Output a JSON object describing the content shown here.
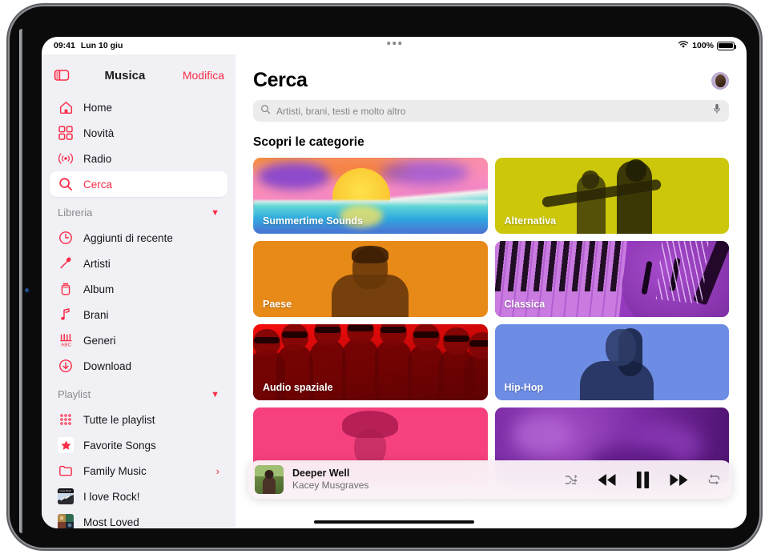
{
  "status_bar": {
    "time": "09:41",
    "date": "Lun 10 giu",
    "wifi_icon": "wifi-icon",
    "battery_percent": "100%",
    "battery_icon": "battery-full-icon",
    "multitask_handle_icon": "multitask-handle-icon"
  },
  "sidebar": {
    "toggle_icon": "sidebar-toggle-icon",
    "title": "Musica",
    "edit_label": "Modifica",
    "nav": [
      {
        "label": "Home",
        "icon": "home-icon",
        "selected": false
      },
      {
        "label": "Novità",
        "icon": "grid-squares-icon",
        "selected": false
      },
      {
        "label": "Radio",
        "icon": "radio-waves-icon",
        "selected": false
      },
      {
        "label": "Cerca",
        "icon": "search-icon",
        "selected": true
      }
    ],
    "library": {
      "header": "Libreria",
      "chevron_icon": "chevron-down-icon",
      "items": [
        {
          "label": "Aggiunti di recente",
          "icon": "clock-icon"
        },
        {
          "label": "Artisti",
          "icon": "microphone-icon"
        },
        {
          "label": "Album",
          "icon": "album-icon"
        },
        {
          "label": "Brani",
          "icon": "music-note-icon"
        },
        {
          "label": "Generi",
          "icon": "genres-icon"
        },
        {
          "label": "Download",
          "icon": "download-arrow-icon"
        }
      ]
    },
    "playlists": {
      "header": "Playlist",
      "chevron_icon": "chevron-down-icon",
      "items": [
        {
          "label": "Tutte le playlist",
          "icon": "playlist-grid-icon",
          "type": "icon"
        },
        {
          "label": "Favorite Songs",
          "icon": "star-icon",
          "type": "icon"
        },
        {
          "label": "Family Music",
          "icon": "folder-icon",
          "type": "icon",
          "disclosure_icon": "chevron-right-icon"
        },
        {
          "label": "I love Rock!",
          "icon": "playlist-artwork",
          "type": "artwork"
        },
        {
          "label": "Most Loved",
          "icon": "playlist-artwork",
          "type": "artwork"
        }
      ]
    }
  },
  "main": {
    "page_title": "Cerca",
    "avatar_icon": "account-avatar",
    "search": {
      "icon": "search-icon",
      "placeholder": "Artisti, brani, testi e molto altro",
      "mic_icon": "microphone-icon"
    },
    "categories_title": "Scopri le categorie",
    "tiles": [
      {
        "label": "Summertime Sounds",
        "art": "sunset-ocean-artwork",
        "accent": "#f9c52e"
      },
      {
        "label": "Alternativa",
        "art": "duotone-duo-photo",
        "accent": "#ccc70a"
      },
      {
        "label": "Paese",
        "art": "duotone-man-photo",
        "accent": "#e88a18"
      },
      {
        "label": "Classica",
        "art": "piano-violin-artwork",
        "accent": "#9e3fc9"
      },
      {
        "label": "Audio spaziale",
        "art": "red-crowd-artwork",
        "accent": "#f60d0d"
      },
      {
        "label": "Hip-Hop",
        "art": "duotone-woman-photo",
        "accent": "#6d8ce3"
      },
      {
        "label": "",
        "art": "pink-hat-woman-artwork",
        "accent": "#f6417e"
      },
      {
        "label": "",
        "art": "purple-smoke-artwork",
        "accent": "#7b2ba4"
      }
    ]
  },
  "mini_player": {
    "artwork_icon": "now-playing-artwork",
    "track_title": "Deeper Well",
    "artist": "Kacey Musgraves",
    "controls": [
      {
        "name": "shuffle-button",
        "icon": "shuffle-icon"
      },
      {
        "name": "rewind-button",
        "icon": "rewind-icon"
      },
      {
        "name": "pause-button",
        "icon": "pause-icon"
      },
      {
        "name": "fast-forward-button",
        "icon": "fast-forward-icon"
      },
      {
        "name": "repeat-button",
        "icon": "repeat-icon"
      }
    ]
  },
  "colors": {
    "accent_red": "#fa2d48",
    "sidebar_bg": "#f1f0f5",
    "search_field_bg": "#ececed"
  }
}
